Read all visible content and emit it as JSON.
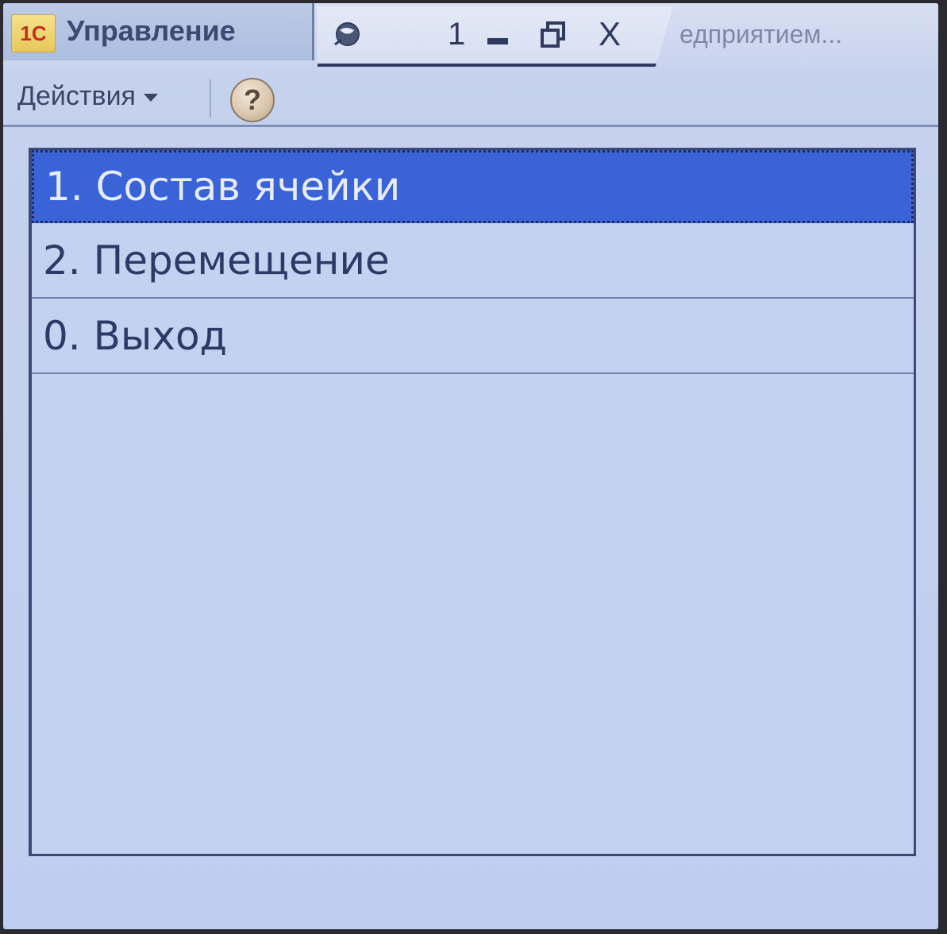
{
  "window": {
    "logo_text": "1С",
    "title": "Управление",
    "number": "1",
    "close_label": "X",
    "right_tab_title": "едприятием..."
  },
  "toolbar": {
    "actions_label": "Действия",
    "help_label": "?"
  },
  "menu": {
    "items": [
      {
        "label": "1. Состав ячейки",
        "selected": true
      },
      {
        "label": "2. Перемещение",
        "selected": false
      },
      {
        "label": "0. Выход",
        "selected": false
      }
    ]
  },
  "colors": {
    "background": "#c4d1f0",
    "selection": "#3a63d8",
    "text": "#2c3a66"
  }
}
